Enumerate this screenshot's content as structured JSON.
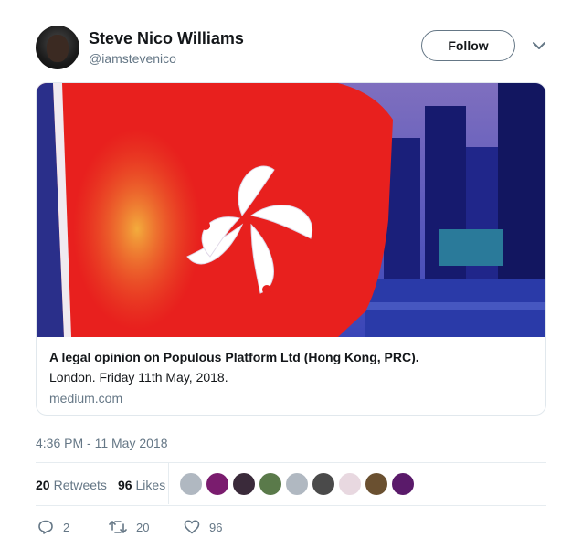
{
  "user": {
    "name": "Steve Nico Williams",
    "handle": "@iamstevenico"
  },
  "follow_label": "Follow",
  "card": {
    "title": "A legal opinion on Populous Platform Ltd (Hong Kong, PRC).",
    "description": "London. Friday 11th May, 2018.",
    "domain": "medium.com"
  },
  "timestamp": "4:36 PM - 11 May 2018",
  "stats": {
    "retweets_count": "20",
    "retweets_label": "Retweets",
    "likes_count": "96",
    "likes_label": "Likes"
  },
  "likers": [
    {
      "color": "#b0b8c1"
    },
    {
      "color": "#7a1c6e"
    },
    {
      "color": "#3a2a3a"
    },
    {
      "color": "#5a7a4a"
    },
    {
      "color": "#b0b8c1"
    },
    {
      "color": "#4a4a4a"
    },
    {
      "color": "#e8d8e0"
    },
    {
      "color": "#6a5030"
    },
    {
      "color": "#5a1a6a"
    }
  ],
  "actions": {
    "replies": "2",
    "retweets": "20",
    "likes": "96"
  },
  "colors": {
    "secondary_text": "#657786",
    "primary_text": "#14171a",
    "border": "#e1e8ed"
  }
}
